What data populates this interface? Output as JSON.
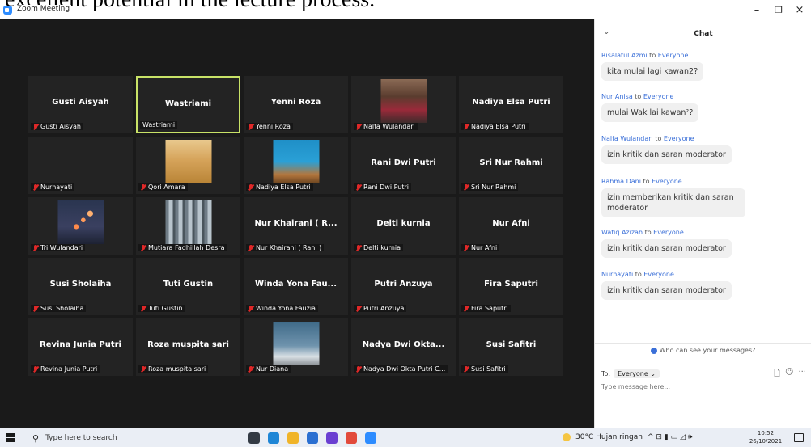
{
  "document": {
    "clipped_text": "excellent potential in the lecture process."
  },
  "window": {
    "title": "Zoom Meeting",
    "minimize": "–",
    "maximize": "❐",
    "close": "×"
  },
  "tiles": [
    {
      "name": "Gusti Aisyah",
      "label": "Gusti Aisyah",
      "muted": true,
      "active": false,
      "photo": ""
    },
    {
      "name": "Wastriami",
      "label": "Wastriami",
      "muted": false,
      "active": true,
      "photo": ""
    },
    {
      "name": "Yenni Roza",
      "label": "Yenni Roza",
      "muted": true,
      "active": false,
      "photo": ""
    },
    {
      "name": "",
      "label": "Nalfa Wulandari",
      "muted": true,
      "active": false,
      "photo": "nalfa"
    },
    {
      "name": "Nadiya Elsa Putri",
      "label": "Nadiya Elsa Putri",
      "muted": true,
      "active": false,
      "photo": ""
    },
    {
      "name": "",
      "label": "Nurhayati",
      "muted": true,
      "active": false,
      "photo": ""
    },
    {
      "name": "",
      "label": "Qori Amara",
      "muted": true,
      "active": false,
      "photo": "qori"
    },
    {
      "name": "",
      "label": "Nadiya Elsa Putri",
      "muted": true,
      "active": false,
      "photo": "nadiya"
    },
    {
      "name": "Rani Dwi Putri",
      "label": "Rani Dwi Putri",
      "muted": true,
      "active": false,
      "photo": ""
    },
    {
      "name": "Sri Nur Rahmi",
      "label": "Sri Nur Rahmi",
      "muted": true,
      "active": false,
      "photo": ""
    },
    {
      "name": "",
      "label": "Tri Wulandari",
      "muted": true,
      "active": false,
      "photo": "tri"
    },
    {
      "name": "",
      "label": "Mutiara Fadhillah Desra",
      "muted": true,
      "active": false,
      "photo": "mutiara"
    },
    {
      "name": "Nur Khairani ( R...",
      "label": "Nur Khairani ( Rani )",
      "muted": true,
      "active": false,
      "photo": ""
    },
    {
      "name": "Delti kurnia",
      "label": "Delti kurnia",
      "muted": true,
      "active": false,
      "photo": ""
    },
    {
      "name": "Nur Afni",
      "label": "Nur Afni",
      "muted": true,
      "active": false,
      "photo": ""
    },
    {
      "name": "Susi Sholaiha",
      "label": "Susi Sholaiha",
      "muted": true,
      "active": false,
      "photo": ""
    },
    {
      "name": "Tuti Gustin",
      "label": "Tuti Gustin",
      "muted": true,
      "active": false,
      "photo": ""
    },
    {
      "name": "Winda Yona Fau...",
      "label": "Winda Yona Fauzia",
      "muted": true,
      "active": false,
      "photo": ""
    },
    {
      "name": "Putri Anzuya",
      "label": "Putri Anzuya",
      "muted": true,
      "active": false,
      "photo": ""
    },
    {
      "name": "Fira Saputri",
      "label": "Fira Saputri",
      "muted": true,
      "active": false,
      "photo": ""
    },
    {
      "name": "Revina Junia Putri",
      "label": "Revina Junia Putri",
      "muted": true,
      "active": false,
      "photo": ""
    },
    {
      "name": "Roza muspita sari",
      "label": "Roza muspita sari",
      "muted": true,
      "active": false,
      "photo": ""
    },
    {
      "name": "",
      "label": "Nur Diana",
      "muted": true,
      "active": false,
      "photo": "nur"
    },
    {
      "name": "Nadya Dwi Okta...",
      "label": "Nadya Dwi Okta Putri C...",
      "muted": true,
      "active": false,
      "photo": ""
    },
    {
      "name": "Susi Safitri",
      "label": "Susi Safitri",
      "muted": true,
      "active": false,
      "photo": ""
    }
  ],
  "chat": {
    "title": "Chat",
    "collapse_icon": "⌄",
    "messages": [
      {
        "sender": "Risalatul Azmi",
        "to": " to ",
        "recipient": "Everyone",
        "text": "kita mulai lagi kawan2?"
      },
      {
        "sender": "Nur Anisa",
        "to": " to ",
        "recipient": "Everyone",
        "text": "mulai Wak lai kawan²?"
      },
      {
        "sender": "Nalfa Wulandari",
        "to": " to ",
        "recipient": "Everyone",
        "text": "izin kritik dan saran moderator"
      },
      {
        "sender": "Rahma Dani",
        "to": " to ",
        "recipient": "Everyone",
        "text": "izin memberikan kritik dan saran moderator"
      },
      {
        "sender": "Wafiq Azizah",
        "to": " to ",
        "recipient": "Everyone",
        "text": "izin kritik dan saran moderator"
      },
      {
        "sender": "Nurhayati",
        "to": " to ",
        "recipient": "Everyone",
        "text": "izin kritik dan saran moderator"
      }
    ],
    "privacy_text": "Who can see your messages?",
    "to_label": "To:",
    "to_value": "Everyone ⌄",
    "file_icon": "🗋",
    "emoji_icon": "☺",
    "more_icon": "···",
    "input_placeholder": "Type message here..."
  },
  "taskbar": {
    "search_placeholder": "Type here to search",
    "search_icon": "⚲",
    "weather": "30°C  Hujan ringan",
    "tray_icons": "^  ⊡  ▮  ▭  ◿  🕪",
    "time": "10:52",
    "date": "26/10/2021",
    "apps": [
      "#333a44",
      "#1f86d6",
      "#f0b429",
      "#2a6fd1",
      "#6a3fd1",
      "#e24a3b",
      "#2d8cff"
    ]
  },
  "colors": {
    "active_border": "#c8e267",
    "accent": "#2d8cff",
    "muted_mic": "#e02828"
  }
}
